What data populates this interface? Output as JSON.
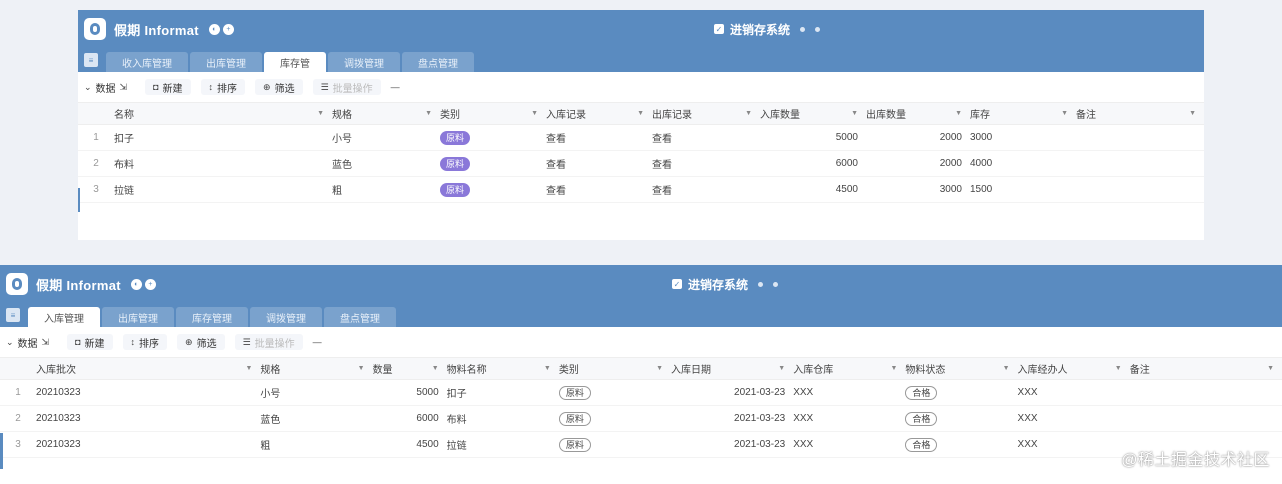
{
  "top": {
    "brand": "假期 Informat",
    "system_title": "进销存系统",
    "tabs": [
      "收入库管理",
      "出库管理",
      "库存管",
      "调拨管理",
      "盘点管理"
    ],
    "toolbar": {
      "group_label": "数据",
      "create_label": "新建",
      "sort_label": "排序",
      "filter_label": "筛选",
      "batch_label": "批量操作"
    },
    "columns": [
      "名称",
      "规格",
      "类别",
      "入库记录",
      "出库记录",
      "入库数量",
      "出库数量",
      "库存",
      "备注"
    ],
    "rows": [
      {
        "idx": "1",
        "name": "扣子",
        "spec": "小号",
        "category": "原料",
        "in_record": "查看",
        "out_record": "查看",
        "in_qty": "5000",
        "out_qty": "2000",
        "stock": "3000"
      },
      {
        "idx": "2",
        "name": "布料",
        "spec": "蓝色",
        "category": "原料",
        "in_record": "查看",
        "out_record": "查看",
        "in_qty": "6000",
        "out_qty": "2000",
        "stock": "4000"
      },
      {
        "idx": "3",
        "name": "拉链",
        "spec": "粗",
        "category": "原料",
        "in_record": "查看",
        "out_record": "查看",
        "in_qty": "4500",
        "out_qty": "3000",
        "stock": "1500"
      }
    ]
  },
  "bottom": {
    "brand": "假期 Informat",
    "system_title": "进销存系统",
    "tabs": [
      "入库管理",
      "出库管理",
      "库存管理",
      "调拨管理",
      "盘点管理"
    ],
    "toolbar": {
      "group_label": "数据",
      "create_label": "新建",
      "sort_label": "排序",
      "filter_label": "筛选",
      "batch_label": "批量操作"
    },
    "columns": [
      "入库批次",
      "规格",
      "数量",
      "物料名称",
      "类别",
      "入库日期",
      "入库仓库",
      "物料状态",
      "入库经办人",
      "备注"
    ],
    "rows": [
      {
        "idx": "1",
        "batch": "20210323",
        "spec": "小号",
        "qty": "5000",
        "material": "扣子",
        "category": "原料",
        "date": "2021-03-23",
        "warehouse": "XXX",
        "status": "合格",
        "handler": "XXX"
      },
      {
        "idx": "2",
        "batch": "20210323",
        "spec": "蓝色",
        "qty": "6000",
        "material": "布料",
        "category": "原料",
        "date": "2021-03-23",
        "warehouse": "XXX",
        "status": "合格",
        "handler": "XXX"
      },
      {
        "idx": "3",
        "batch": "20210323",
        "spec": "粗",
        "qty": "4500",
        "material": "拉链",
        "category": "原料",
        "date": "2021-03-23",
        "warehouse": "XXX",
        "status": "合格",
        "handler": "XXX"
      }
    ]
  },
  "watermark": "@稀土掘金技术社区",
  "colors": {
    "header_blue": "#5a8bc0",
    "tab_inactive": "#7aa2cd",
    "badge_purple": "#8a78d9"
  }
}
